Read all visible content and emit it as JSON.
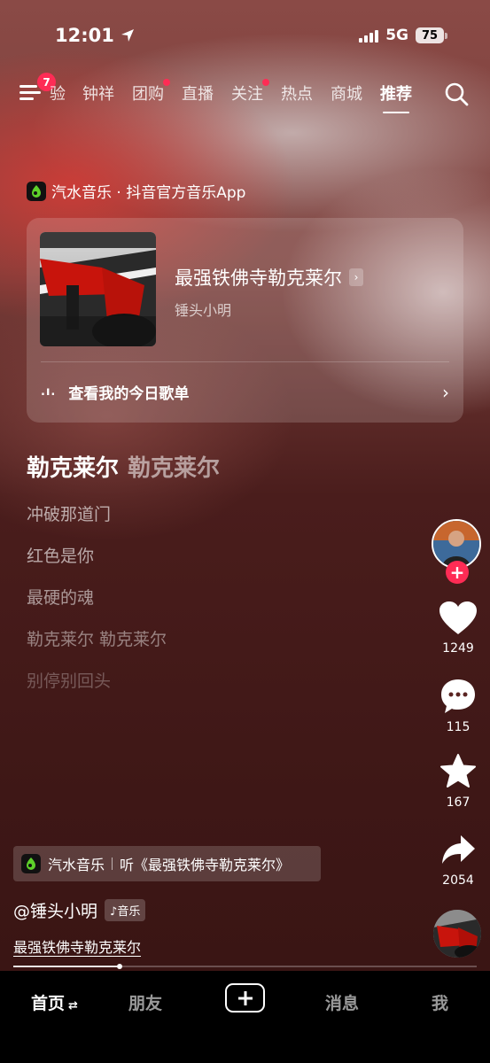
{
  "status": {
    "time": "12:01",
    "network": "5G",
    "battery": "75"
  },
  "nav": {
    "menu_badge": "7",
    "tabs": [
      {
        "label": "验",
        "dot": false
      },
      {
        "label": "钟祥",
        "dot": false
      },
      {
        "label": "团购",
        "dot": true
      },
      {
        "label": "直播",
        "dot": false
      },
      {
        "label": "关注",
        "dot": true
      },
      {
        "label": "热点",
        "dot": false
      },
      {
        "label": "商城",
        "dot": false
      },
      {
        "label": "推荐",
        "dot": false,
        "active": true
      }
    ]
  },
  "music_source": "汽水音乐 · 抖音官方音乐App",
  "music_card": {
    "song_title": "最强铁佛寺勒克莱尔",
    "artist": "锤头小明",
    "playlist_bars": ".ı.",
    "playlist_label": "查看我的今日歌单"
  },
  "lyrics": {
    "heading_main": "勒克莱尔",
    "heading_dim": "勒克莱尔",
    "lines": [
      "冲破那道门",
      "红色是你",
      "最硬的魂",
      "勒克莱尔 勒克莱尔",
      "别停别回头"
    ]
  },
  "actions": {
    "likes": "1249",
    "comments": "115",
    "favorites": "167",
    "shares": "2054"
  },
  "bottom_info": {
    "anchor_app": "汽水音乐",
    "anchor_text": "听《最强铁佛寺勒克莱尔》",
    "author": "@锤头小明",
    "music_tag": "音乐",
    "caption": "最强铁佛寺勒克莱尔",
    "progress": 0.23
  },
  "tabbar": {
    "home": "首页",
    "friends": "朋友",
    "messages": "消息",
    "me": "我"
  },
  "colors": {
    "accent": "#fe2c55",
    "tabbar_bg": "#000000"
  }
}
